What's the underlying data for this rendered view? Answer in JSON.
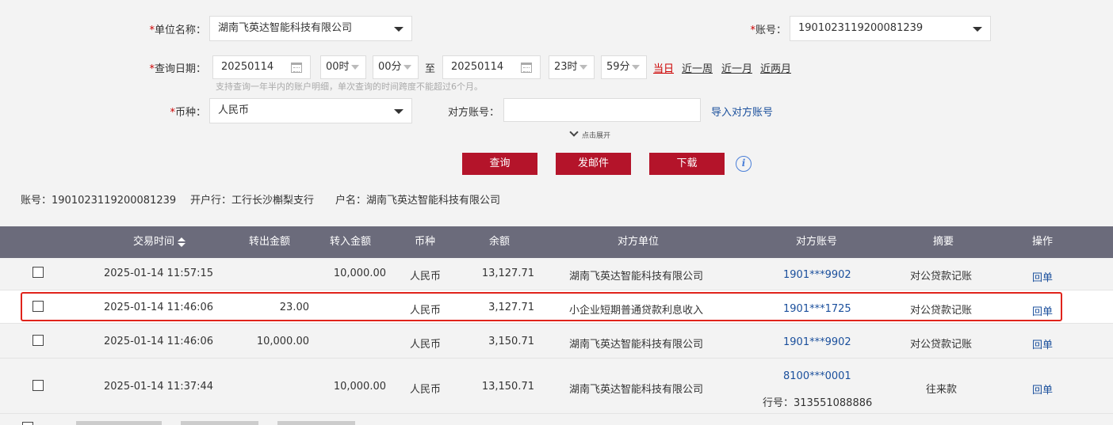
{
  "form": {
    "unit_label": "单位名称：",
    "unit_value": "湖南飞英达智能科技有限公司",
    "account_label": "账号：",
    "account_value": "1901023119200081239",
    "date_label": "查询日期：",
    "start_date": "20250114",
    "start_hour": "00时",
    "start_min": "00分",
    "to_label": "至",
    "end_date": "20250114",
    "end_hour": "23时",
    "end_min": "59分",
    "quick_links": [
      "当日",
      "近一周",
      "近一月",
      "近两月"
    ],
    "hint": "支持查询一年半内的账户明细，单次查询的时间跨度不能超过6个月。",
    "currency_label": "币种：",
    "currency_value": "人民币",
    "counter_account_label": "对方账号：",
    "counter_account_value": "",
    "import_link": "导入对方账号",
    "expand_label": "点击展开",
    "required_mark": "*"
  },
  "buttons": {
    "query": "查询",
    "email": "发邮件",
    "download": "下载"
  },
  "account_info": {
    "account": "账号：1901023119200081239",
    "bank": "开户行：工行长沙槲梨支行",
    "holder": "户名：湖南飞英达智能科技有限公司"
  },
  "table": {
    "headers": [
      "交易时间",
      "转出金额",
      "转入金额",
      "币种",
      "余额",
      "对方单位",
      "对方账号",
      "摘要",
      "操作"
    ],
    "rows": [
      {
        "time": "2025-01-14  11:57:15",
        "out": "",
        "in": "10,000.00",
        "currency": "人民币",
        "balance": "13,127.71",
        "counterparty": "湖南飞英达智能科技有限公司",
        "counter_account": "1901***9902",
        "bank_no": "",
        "summary": "对公贷款记账",
        "action": "回单"
      },
      {
        "time": "2025-01-14  11:46:06",
        "out": "23.00",
        "in": "",
        "currency": "人民币",
        "balance": "3,127.71",
        "counterparty": "小企业短期普通贷款利息收入",
        "counter_account": "1901***1725",
        "bank_no": "",
        "summary": "对公贷款记账",
        "action": "回单"
      },
      {
        "time": "2025-01-14  11:46:06",
        "out": "10,000.00",
        "in": "",
        "currency": "人民币",
        "balance": "3,150.71",
        "counterparty": "湖南飞英达智能科技有限公司",
        "counter_account": "1901***9902",
        "bank_no": "",
        "summary": "对公贷款记账",
        "action": "回单"
      },
      {
        "time": "2025-01-14  11:37:44",
        "out": "",
        "in": "10,000.00",
        "currency": "人民币",
        "balance": "13,150.71",
        "counterparty": "湖南飞英达智能科技有限公司",
        "counter_account": "8100***0001",
        "bank_no": "行号：313551088886",
        "summary": "往来款",
        "action": "回单"
      }
    ]
  },
  "colors": {
    "accent": "#b4142a",
    "header_bg": "#6b6b7b",
    "link": "#1a4f9c",
    "highlight": "#e0231b"
  }
}
